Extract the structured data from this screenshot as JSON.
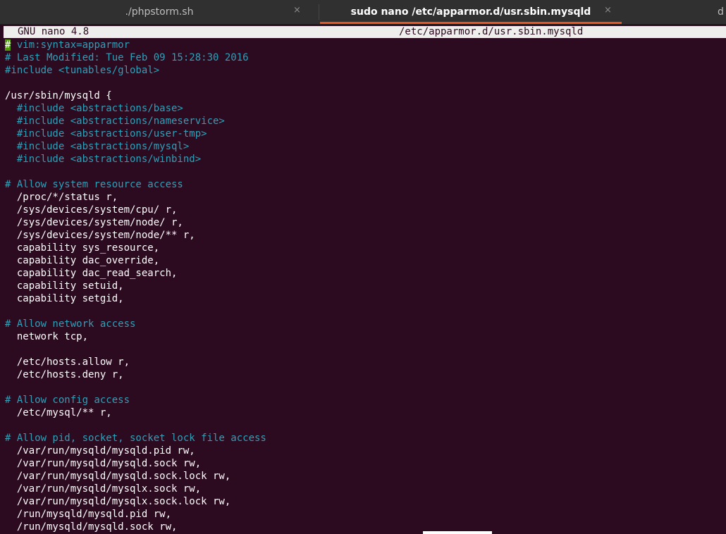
{
  "tabs": [
    {
      "label": "./phpstorm.sh",
      "active": false
    },
    {
      "label": "sudo nano /etc/apparmor.d/usr.sbin.mysqld",
      "active": true
    },
    {
      "label": "d",
      "active": false
    }
  ],
  "tab_close_glyph": "×",
  "nano": {
    "version": "GNU nano 4.8",
    "filename": "/etc/apparmor.d/usr.sbin.mysqld"
  },
  "colors": {
    "background": "#2c0a1f",
    "comment": "#2ea0b8",
    "accent": "#e95420",
    "header_bg": "#eeeeec"
  },
  "editor": {
    "cursor_char": "#",
    "lines": [
      {
        "text": " vim:syntax=apparmor",
        "type": "comment"
      },
      {
        "text": "# Last Modified: Tue Feb 09 15:28:30 2016",
        "type": "comment"
      },
      {
        "text": "#include <tunables/global>",
        "type": "comment"
      },
      {
        "text": "",
        "type": "text"
      },
      {
        "text": "/usr/sbin/mysqld {",
        "type": "text"
      },
      {
        "text": "  #include <abstractions/base>",
        "type": "comment"
      },
      {
        "text": "  #include <abstractions/nameservice>",
        "type": "comment"
      },
      {
        "text": "  #include <abstractions/user-tmp>",
        "type": "comment"
      },
      {
        "text": "  #include <abstractions/mysql>",
        "type": "comment"
      },
      {
        "text": "  #include <abstractions/winbind>",
        "type": "comment"
      },
      {
        "text": "",
        "type": "text"
      },
      {
        "text": "# Allow system resource access",
        "type": "comment"
      },
      {
        "text": "  /proc/*/status r,",
        "type": "text"
      },
      {
        "text": "  /sys/devices/system/cpu/ r,",
        "type": "text"
      },
      {
        "text": "  /sys/devices/system/node/ r,",
        "type": "text"
      },
      {
        "text": "  /sys/devices/system/node/** r,",
        "type": "text"
      },
      {
        "text": "  capability sys_resource,",
        "type": "text"
      },
      {
        "text": "  capability dac_override,",
        "type": "text"
      },
      {
        "text": "  capability dac_read_search,",
        "type": "text"
      },
      {
        "text": "  capability setuid,",
        "type": "text"
      },
      {
        "text": "  capability setgid,",
        "type": "text"
      },
      {
        "text": "",
        "type": "text"
      },
      {
        "text": "# Allow network access",
        "type": "comment"
      },
      {
        "text": "  network tcp,",
        "type": "text"
      },
      {
        "text": "",
        "type": "text"
      },
      {
        "text": "  /etc/hosts.allow r,",
        "type": "text"
      },
      {
        "text": "  /etc/hosts.deny r,",
        "type": "text"
      },
      {
        "text": "",
        "type": "text"
      },
      {
        "text": "# Allow config access",
        "type": "comment"
      },
      {
        "text": "  /etc/mysql/** r,",
        "type": "text"
      },
      {
        "text": "",
        "type": "text"
      },
      {
        "text": "# Allow pid, socket, socket lock file access",
        "type": "comment"
      },
      {
        "text": "  /var/run/mysqld/mysqld.pid rw,",
        "type": "text"
      },
      {
        "text": "  /var/run/mysqld/mysqld.sock rw,",
        "type": "text"
      },
      {
        "text": "  /var/run/mysqld/mysqld.sock.lock rw,",
        "type": "text"
      },
      {
        "text": "  /var/run/mysqld/mysqlx.sock rw,",
        "type": "text"
      },
      {
        "text": "  /var/run/mysqld/mysqlx.sock.lock rw,",
        "type": "text"
      },
      {
        "text": "  /run/mysqld/mysqld.pid rw,",
        "type": "text"
      },
      {
        "text": "  /run/mysqld/mysqld.sock rw,",
        "type": "text"
      }
    ]
  }
}
